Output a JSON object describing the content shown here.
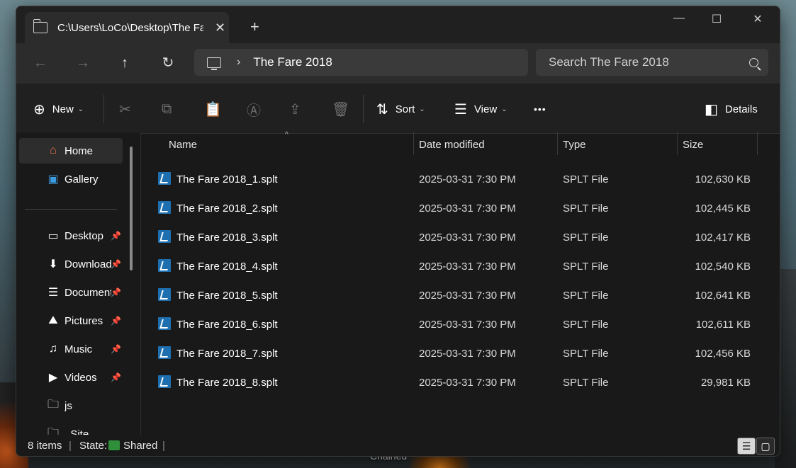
{
  "window": {
    "tab_title": "C:\\Users\\LoCo\\Desktop\\The Fa",
    "tab_close": "✕",
    "new_tab": "+",
    "minimize": "—",
    "maximize": "☐",
    "close": "✕"
  },
  "nav": {
    "back": "←",
    "forward": "→",
    "up": "↑",
    "refresh": "↻",
    "crumb_sep": "›",
    "breadcrumb": "The Fare 2018",
    "search_placeholder": "Search The Fare 2018"
  },
  "toolbar": {
    "new_label": "New",
    "sort_label": "Sort",
    "view_label": "View",
    "more": "•••",
    "details_label": "Details"
  },
  "sidebar": {
    "items": [
      {
        "label": "Home",
        "icon": "home-icon",
        "pinned": false
      },
      {
        "label": "Gallery",
        "icon": "gallery-icon",
        "pinned": false
      },
      {
        "label": "Desktop",
        "icon": "desktop-icon",
        "pinned": true
      },
      {
        "label": "Downloads",
        "icon": "download-icon",
        "pinned": true
      },
      {
        "label": "Documents",
        "icon": "documents-icon",
        "pinned": true
      },
      {
        "label": "Pictures",
        "icon": "pictures-icon",
        "pinned": true
      },
      {
        "label": "Music",
        "icon": "music-icon",
        "pinned": true
      },
      {
        "label": "Videos",
        "icon": "videos-icon",
        "pinned": true
      },
      {
        "label": "js",
        "icon": "folder-icon",
        "pinned": false
      },
      {
        "label": "_Site",
        "icon": "folder-icon",
        "pinned": false
      }
    ]
  },
  "columns": {
    "name": "Name",
    "date": "Date modified",
    "type": "Type",
    "size": "Size"
  },
  "files": [
    {
      "name": "The Fare 2018_1.splt",
      "date": "2025-03-31 7:30 PM",
      "type": "SPLT File",
      "size": "102,630 KB"
    },
    {
      "name": "The Fare 2018_2.splt",
      "date": "2025-03-31 7:30 PM",
      "type": "SPLT File",
      "size": "102,445 KB"
    },
    {
      "name": "The Fare 2018_3.splt",
      "date": "2025-03-31 7:30 PM",
      "type": "SPLT File",
      "size": "102,417 KB"
    },
    {
      "name": "The Fare 2018_4.splt",
      "date": "2025-03-31 7:30 PM",
      "type": "SPLT File",
      "size": "102,540 KB"
    },
    {
      "name": "The Fare 2018_5.splt",
      "date": "2025-03-31 7:30 PM",
      "type": "SPLT File",
      "size": "102,641 KB"
    },
    {
      "name": "The Fare 2018_6.splt",
      "date": "2025-03-31 7:30 PM",
      "type": "SPLT File",
      "size": "102,611 KB"
    },
    {
      "name": "The Fare 2018_7.splt",
      "date": "2025-03-31 7:30 PM",
      "type": "SPLT File",
      "size": "102,456 KB"
    },
    {
      "name": "The Fare 2018_8.splt",
      "date": "2025-03-31 7:30 PM",
      "type": "SPLT File",
      "size": "29,981 KB"
    }
  ],
  "status": {
    "item_count": "8 items",
    "state_label": "State:",
    "state_value": "Shared"
  },
  "desktop": {
    "icon_label": "Chained"
  },
  "colors": {
    "window_bg": "#191919",
    "titlebar_bg": "#202020",
    "field_bg": "#3a3a3a",
    "file_icon": "#1e6fb0",
    "shared_icon": "#2f8f3a"
  }
}
